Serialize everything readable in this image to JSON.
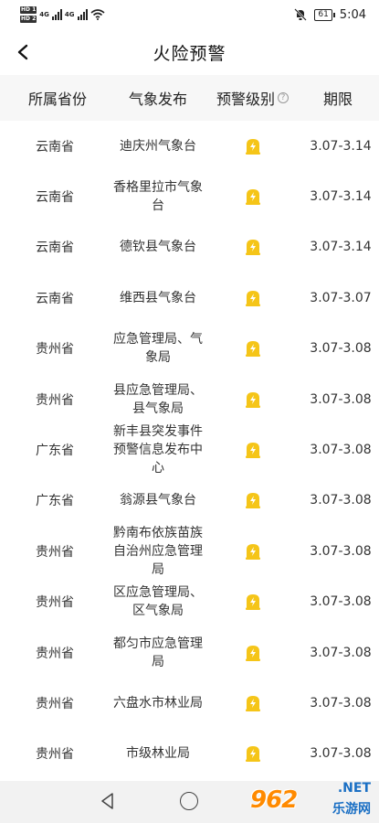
{
  "status_bar": {
    "hd1": "HD 1",
    "hd2": "HD 2",
    "net1": "4G",
    "net2": "4G",
    "battery": "61",
    "time": "5:04"
  },
  "header": {
    "title": "火险预警"
  },
  "table": {
    "columns": [
      "所属省份",
      "气象发布",
      "预警级别",
      "期限"
    ],
    "rows": [
      {
        "province": "云南省",
        "issuer": "迪庆州气象台",
        "period": "3.07-3.14"
      },
      {
        "province": "云南省",
        "issuer": "香格里拉市气象台",
        "period": "3.07-3.14"
      },
      {
        "province": "云南省",
        "issuer": "德钦县气象台",
        "period": "3.07-3.14"
      },
      {
        "province": "云南省",
        "issuer": "维西县气象台",
        "period": "3.07-3.07"
      },
      {
        "province": "贵州省",
        "issuer": "应急管理局、气象局",
        "period": "3.07-3.08"
      },
      {
        "province": "贵州省",
        "issuer": "县应急管理局、县气象局",
        "period": "3.07-3.08"
      },
      {
        "province": "广东省",
        "issuer": "新丰县突发事件预警信息发布中心",
        "period": "3.07-3.08"
      },
      {
        "province": "广东省",
        "issuer": "翁源县气象台",
        "period": "3.07-3.08"
      },
      {
        "province": "贵州省",
        "issuer": "黔南布依族苗族自治州应急管理局",
        "period": "3.07-3.08"
      },
      {
        "province": "贵州省",
        "issuer": "区应急管理局、区气象局",
        "period": "3.07-3.08"
      },
      {
        "province": "贵州省",
        "issuer": "都匀市应急管理局",
        "period": "3.07-3.08"
      },
      {
        "province": "贵州省",
        "issuer": "六盘水市林业局",
        "period": "3.07-3.08"
      },
      {
        "province": "贵州省",
        "issuer": "市级林业局",
        "period": "3.07-3.08"
      }
    ]
  },
  "colors": {
    "warning_level": "#f5c518",
    "header_bg": "#f7f7f7"
  },
  "icons": {
    "back": "chevron-left-icon",
    "help": "question-icon",
    "warning": "yellow-lightning-badge-icon"
  },
  "watermark": {
    "logo": "962",
    "net": ".NET",
    "sub": "乐游网"
  }
}
